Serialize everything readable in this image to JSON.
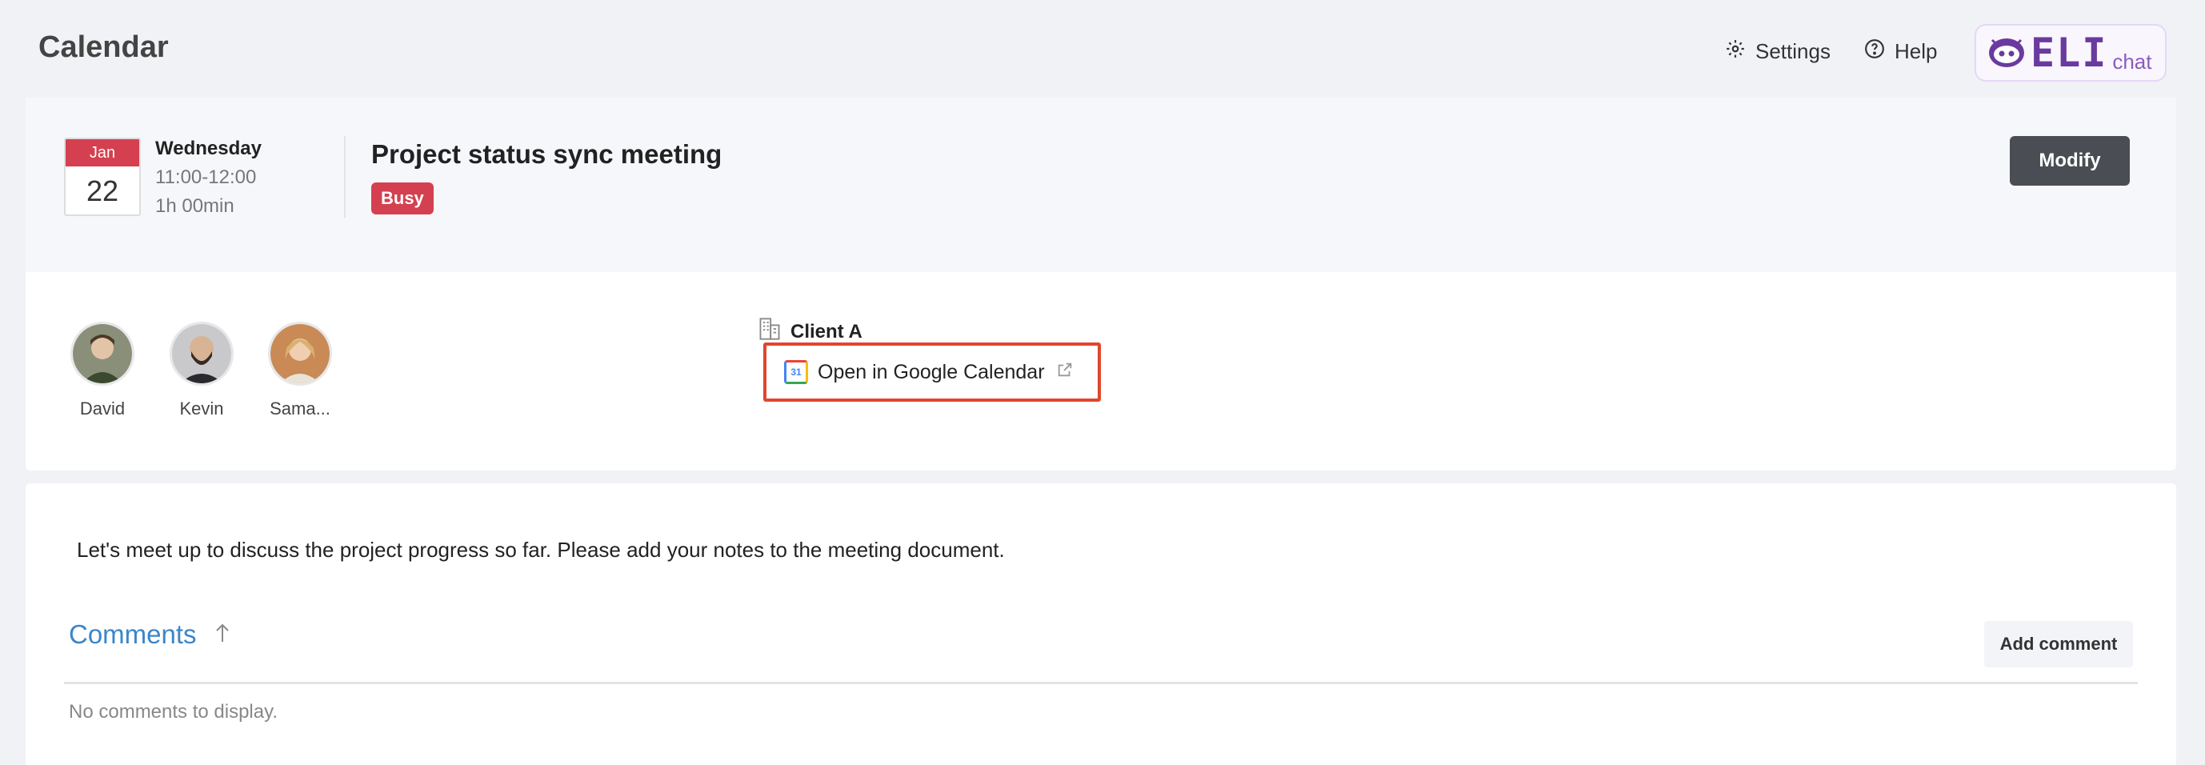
{
  "header": {
    "title": "Calendar",
    "settings_label": "Settings",
    "help_label": "Help",
    "logo": {
      "text": "ELI",
      "suffix": "chat",
      "accent": "#6a3a9e"
    }
  },
  "event": {
    "month": "Jan",
    "day": "22",
    "weekday": "Wednesday",
    "time_range": "11:00-12:00",
    "duration": "1h 00min",
    "title": "Project status sync meeting",
    "status": "Busy",
    "status_color": "#d4404f",
    "modify_label": "Modify"
  },
  "attendees": [
    {
      "name": "David",
      "avatar_color": "#5a6b4a"
    },
    {
      "name": "Kevin",
      "avatar_color": "#6b5440"
    },
    {
      "name": "Sama...",
      "avatar_color": "#b87a4f"
    }
  ],
  "details": {
    "client": "Client A",
    "google_calendar_label": "Open in Google Calendar",
    "gcal_icon_text": "31"
  },
  "description": "Let's meet up to discuss the project progress so far. Please add your notes to the meeting document.",
  "comments": {
    "heading": "Comments",
    "add_label": "Add comment",
    "empty_text": "No comments to display."
  }
}
